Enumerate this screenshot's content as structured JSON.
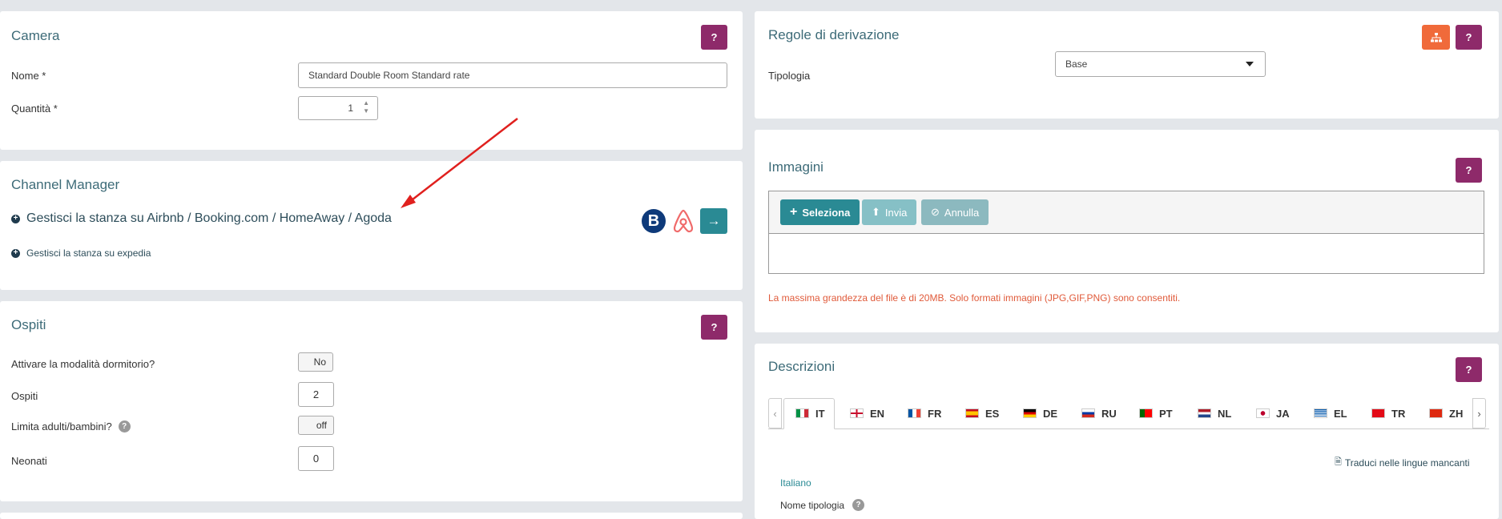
{
  "camera": {
    "title": "Camera",
    "help_label": "?",
    "name_label": "Nome *",
    "name_value": "Standard Double Room Standard rate",
    "qty_label": "Quantità *",
    "qty_value": "1"
  },
  "channel": {
    "title": "Channel Manager",
    "link1": "Gestisci la stanza su Airbnb / Booking.com / HomeAway / Agoda",
    "link2": "Gestisci la stanza su expedia",
    "booking_logo": "B",
    "go_icon": "→"
  },
  "ospiti": {
    "title": "Ospiti",
    "help_label": "?",
    "dorm_label": "Attivare la modalità dormitorio?",
    "dorm_value": "No",
    "guests_label": "Ospiti",
    "guests_value": "2",
    "limit_label": "Limita adulti/bambini?",
    "limit_value": "off",
    "infants_label": "Neonati",
    "infants_value": "0"
  },
  "regole": {
    "title": "Regole di derivazione",
    "help_label": "?",
    "tipologia_label": "Tipologia",
    "tipologia_value": "Base"
  },
  "immagini": {
    "title": "Immagini",
    "help_label": "?",
    "select_label": "Seleziona",
    "upload_label": "Invia",
    "cancel_label": "Annulla",
    "note": "La massima grandezza del file è di 20MB. Solo formati immagini (JPG,GIF,PNG) sono consentiti."
  },
  "descrizioni": {
    "title": "Descrizioni",
    "help_label": "?",
    "tabs": [
      {
        "code": "IT"
      },
      {
        "code": "EN"
      },
      {
        "code": "FR"
      },
      {
        "code": "ES"
      },
      {
        "code": "DE"
      },
      {
        "code": "RU"
      },
      {
        "code": "PT"
      },
      {
        "code": "NL"
      },
      {
        "code": "JA"
      },
      {
        "code": "EL"
      },
      {
        "code": "TR"
      },
      {
        "code": "ZH"
      }
    ],
    "translate_label": "Traduci nelle lingue mancanti",
    "language_name": "Italiano",
    "nome_tipologia_label": "Nome tipologia"
  },
  "colors": {
    "help": "#8e2a6a",
    "teal": "#2a8a94",
    "orange": "#f06a3a",
    "note_red": "#e05a3a"
  }
}
